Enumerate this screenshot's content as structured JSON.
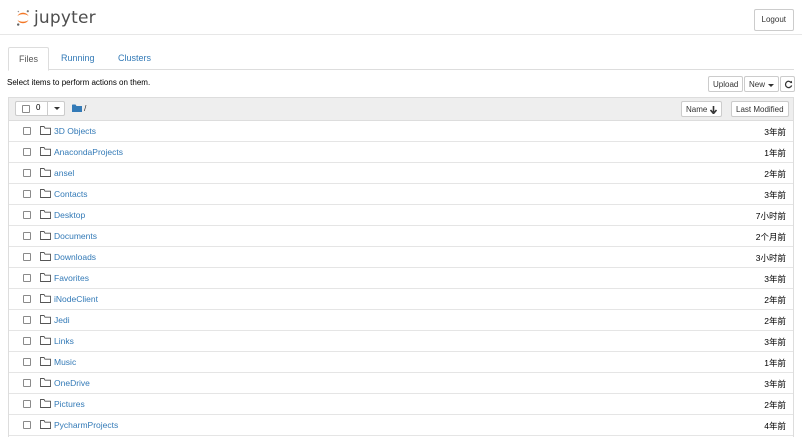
{
  "header": {
    "logo_text": "jupyter",
    "logout_label": "Logout"
  },
  "tabs": [
    {
      "label": "Files",
      "active": true
    },
    {
      "label": "Running",
      "active": false
    },
    {
      "label": "Clusters",
      "active": false
    }
  ],
  "toolbar": {
    "hint": "Select items to perform actions on them.",
    "upload_label": "Upload",
    "new_label": "New",
    "refresh_icon": "refresh-icon"
  },
  "list_header": {
    "selected_count": "0",
    "path": "/",
    "sort_name_label": "Name",
    "sort_modified_label": "Last Modified"
  },
  "files": [
    {
      "name": "3D Objects",
      "modified": "3年前"
    },
    {
      "name": "AnacondaProjects",
      "modified": "1年前"
    },
    {
      "name": "ansel",
      "modified": "2年前"
    },
    {
      "name": "Contacts",
      "modified": "3年前"
    },
    {
      "name": "Desktop",
      "modified": "7小时前"
    },
    {
      "name": "Documents",
      "modified": "2个月前"
    },
    {
      "name": "Downloads",
      "modified": "3小时前"
    },
    {
      "name": "Favorites",
      "modified": "3年前"
    },
    {
      "name": "iNodeClient",
      "modified": "2年前"
    },
    {
      "name": "Jedi",
      "modified": "2年前"
    },
    {
      "name": "Links",
      "modified": "3年前"
    },
    {
      "name": "Music",
      "modified": "1年前"
    },
    {
      "name": "OneDrive",
      "modified": "3年前"
    },
    {
      "name": "Pictures",
      "modified": "2年前"
    },
    {
      "name": "PycharmProjects",
      "modified": "4年前"
    }
  ],
  "colors": {
    "link": "#337ab7",
    "logo_orange": "#f37726",
    "header_bg": "#eeeeee"
  }
}
